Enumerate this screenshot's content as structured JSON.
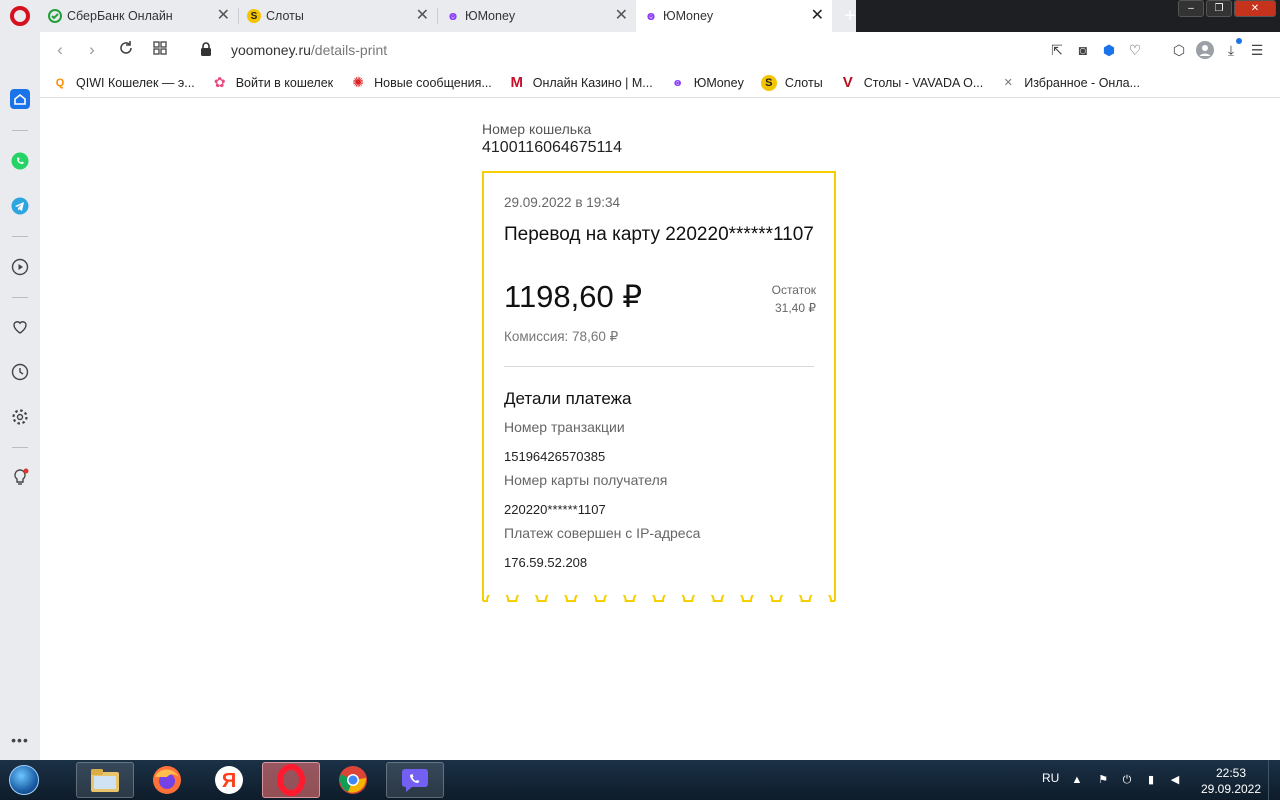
{
  "browser": {
    "tabs": [
      {
        "title": "СберБанк Онлайн",
        "active": false
      },
      {
        "title": "Слоты",
        "active": false
      },
      {
        "title": "ЮMoney",
        "active": false
      },
      {
        "title": "ЮMoney",
        "active": true
      }
    ],
    "address": {
      "domain": "yoomoney.ru",
      "path": "/details-print"
    },
    "bookmarks": [
      {
        "label": "QIWI Кошелек — э...",
        "icon": "qiwi-icon"
      },
      {
        "label": "Войти в кошелек",
        "icon": "flower-icon"
      },
      {
        "label": "Новые сообщения...",
        "icon": "ring-icon"
      },
      {
        "label": "Онлайн Казино | М...",
        "icon": "m-logo-icon"
      },
      {
        "label": "ЮMoney",
        "icon": "yoomoney-icon"
      },
      {
        "label": "Слоты",
        "icon": "slots-icon"
      },
      {
        "label": "Столы - VAVADA O...",
        "icon": "v-logo-icon"
      },
      {
        "label": "Избранное - Онла...",
        "icon": "onex-icon"
      }
    ],
    "colors": {
      "accent": "#1a73e8",
      "opera_red": "#d8101e",
      "receipt_border": "#f5cf00",
      "yoomoney_purple": "#8b3ffd"
    }
  },
  "page": {
    "wallet_label": "Номер кошелька",
    "wallet_number": "4100116064675114",
    "receipt": {
      "date": "29.09.2022 в 19:34",
      "title": "Перевод на карту 220220******1107",
      "amount": "1198,60 ₽",
      "rest_label": "Остаток",
      "rest_value": "31,40 ₽",
      "fee": "Комиссия: 78,60 ₽",
      "section_title": "Детали платежа",
      "details": [
        {
          "label": "Номер транзакции",
          "value": "15196426570385"
        },
        {
          "label": "Номер карты получателя",
          "value": "220220******1107"
        },
        {
          "label": "Платеж совершен с IP-адреса",
          "value": "176.59.52.208"
        }
      ]
    }
  },
  "taskbar": {
    "lang": "RU",
    "time": "22:53",
    "date": "29.09.2022"
  }
}
